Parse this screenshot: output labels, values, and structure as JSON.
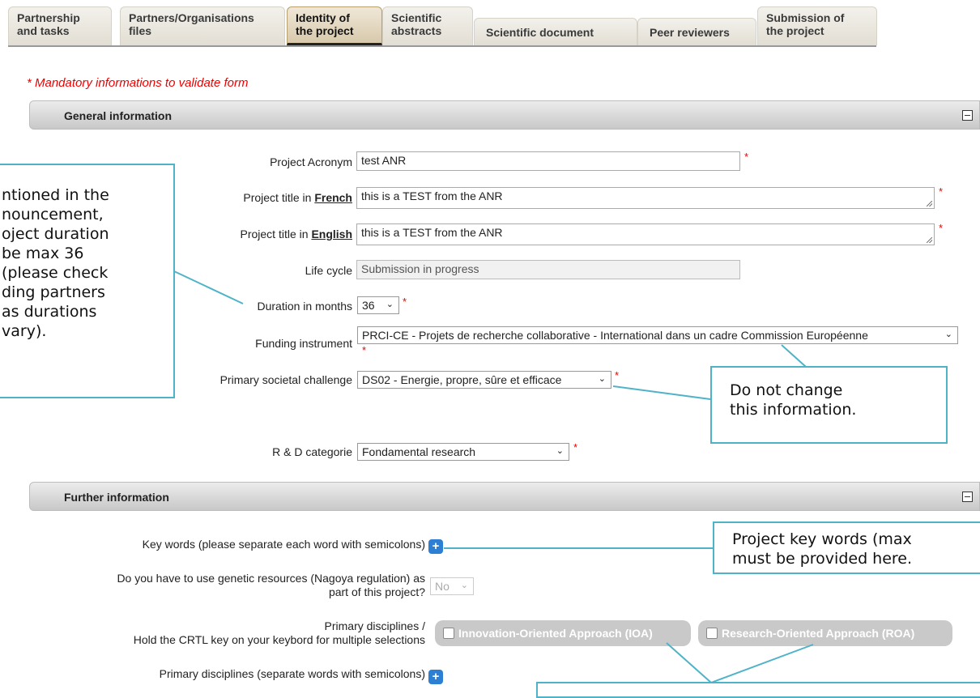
{
  "tabs": [
    {
      "line1": "Partnership",
      "line2": "and tasks",
      "active": false
    },
    {
      "line1": "Partners/Organisations",
      "line2": "files",
      "active": false
    },
    {
      "line1": "Identity of",
      "line2": "the project",
      "active": true
    },
    {
      "line1": "Scientific",
      "line2": "abstracts",
      "active": false
    },
    {
      "line1": "Scientific document",
      "active": false
    },
    {
      "line1": "Peer reviewers",
      "active": false
    },
    {
      "line1": "Submission of",
      "line2": "the project",
      "active": false
    }
  ],
  "mandatory_note": "* Mandatory informations to validate form",
  "general": {
    "title": "General information",
    "acronym_label": "Project Acronym",
    "acronym_value": "test ANR",
    "title_fr_label_pre": "Project title in ",
    "title_fr_label_bold": "French",
    "title_fr_value": "this is a TEST from the ANR",
    "title_en_label_pre": "Project title in ",
    "title_en_label_bold": "English",
    "title_en_value": "this is a TEST from the ANR",
    "lifecycle_label": "Life cycle",
    "lifecycle_value": "Submission in progress",
    "duration_label": "Duration in months",
    "duration_value": "36",
    "funding_label": "Funding instrument",
    "funding_value": "PRCI-CE - Projets de recherche collaborative - International dans un cadre Commission Européenne",
    "challenge_label": "Primary societal challenge",
    "challenge_value": "DS02 - Energie, propre, sûre et efficace",
    "rd_label": "R & D categorie",
    "rd_value": "Fondamental research"
  },
  "further": {
    "title": "Further information",
    "keywords_label": "Key words (please separate each word with semicolons)",
    "nagoya_label_1": "Do you have to use genetic resources (Nagoya regulation) as",
    "nagoya_label_2": "part of this project?",
    "nagoya_value": "No",
    "disciplines_label_1": "Primary disciplines /",
    "disciplines_label_2": "Hold the CRTL key on your keybord for multiple selections",
    "ioa_label": "Innovation-Oriented Approach (IOA)",
    "roa_label": "Research-Oriented Approach (ROA)",
    "disciplines_kw_label": "Primary disciplines (separate words with semicolons)"
  },
  "callouts": {
    "duration_lines": [
      "ntioned in the",
      "nouncement,",
      "oject duration",
      "be max 36",
      "(please check",
      "ding partners",
      "as durations",
      "vary)."
    ],
    "funding_lines": [
      "Do not change",
      "this information."
    ],
    "keywords_lines": [
      "Project key words (max",
      "must be provided here."
    ]
  },
  "colors": {
    "callout_border": "#4fb3c8",
    "required": "#e00000",
    "plus_button": "#2d7fd4"
  }
}
